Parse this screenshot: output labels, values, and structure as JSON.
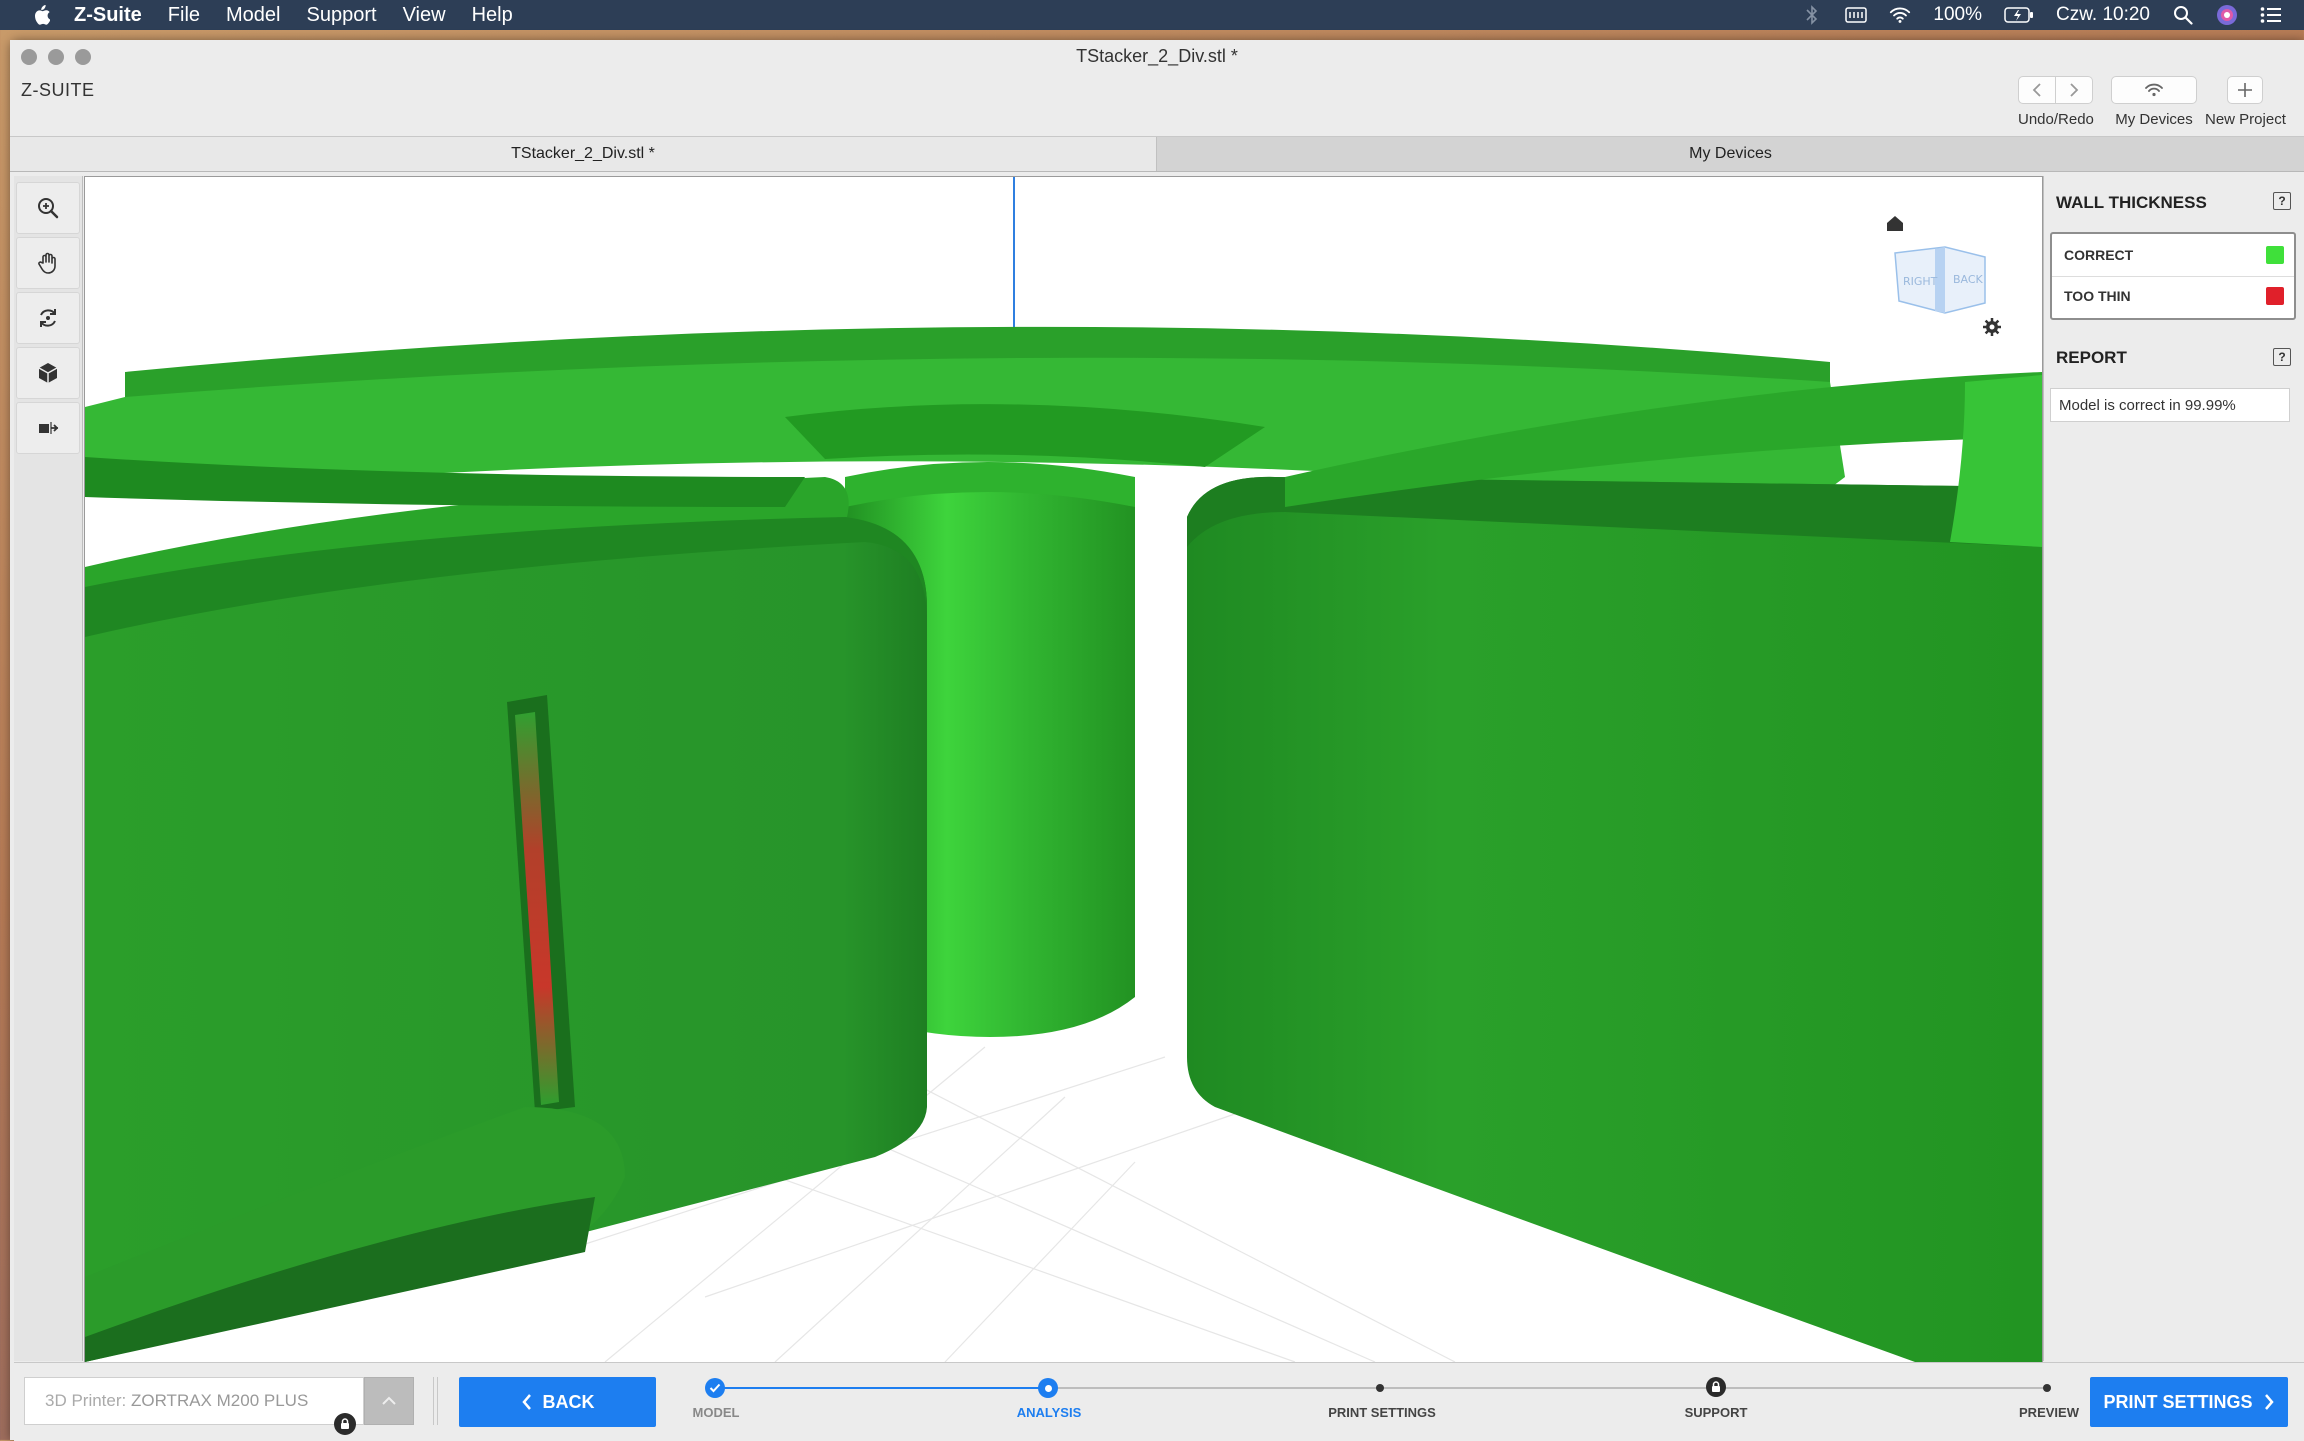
{
  "menubar": {
    "app_name": "Z-Suite",
    "items": [
      "File",
      "Model",
      "Support",
      "View",
      "Help"
    ],
    "battery": "100%",
    "clock": "Czw. 10:20"
  },
  "window": {
    "title": "TStacker_2_Div.stl *",
    "brand": "Z-SUITE"
  },
  "toolbar": {
    "undo_redo_label": "Undo/Redo",
    "my_devices_label": "My Devices",
    "new_project_label": "New Project"
  },
  "tabs": [
    {
      "label": "TStacker_2_Div.stl *",
      "active": true
    },
    {
      "label": "My Devices",
      "active": false
    }
  ],
  "tools": [
    "zoom-icon",
    "pan-hand-icon",
    "rotate-icon",
    "view-cube-icon",
    "model-move-icon"
  ],
  "viewcube": {
    "faces": [
      "RIGHT",
      "BACK"
    ]
  },
  "panel": {
    "wall_thickness_title": "WALL THICKNESS",
    "legend": [
      {
        "label": "CORRECT",
        "color": "#3fe03a"
      },
      {
        "label": "TOO THIN",
        "color": "#e0202a"
      }
    ],
    "report_title": "REPORT",
    "report_text": "Model is correct in 99.99%"
  },
  "bottom": {
    "printer_prefix": "3D Printer: ",
    "printer_name": "ZORTRAX M200 PLUS",
    "back_label": "BACK",
    "next_label": "PRINT SETTINGS",
    "steps": [
      {
        "label": "MODEL",
        "state": "done"
      },
      {
        "label": "ANALYSIS",
        "state": "current"
      },
      {
        "label": "PRINT SETTINGS",
        "state": "pending"
      },
      {
        "label": "SUPPORT",
        "state": "locked"
      },
      {
        "label": "PREVIEW",
        "state": "pending"
      }
    ]
  },
  "colors": {
    "accent": "#1d7ef0",
    "model_green": "#2a9a28",
    "thin_red": "#c8372a"
  }
}
